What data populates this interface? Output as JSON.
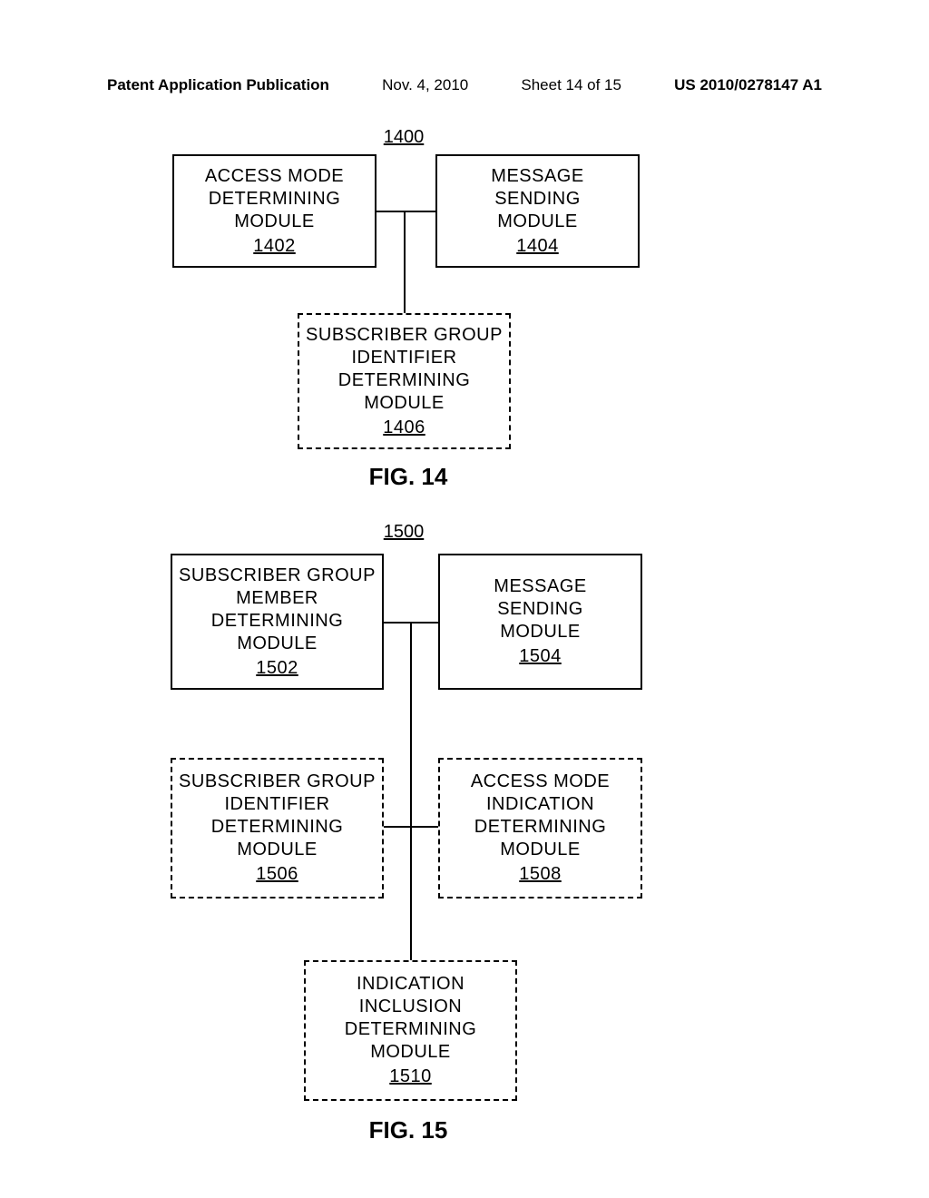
{
  "header": {
    "pub_label": "Patent Application Publication",
    "date": "Nov. 4, 2010",
    "sheet": "Sheet 14 of 15",
    "pubno": "US 2010/0278147 A1"
  },
  "fig14": {
    "ref": "1400",
    "label": "FIG. 14",
    "box1": {
      "line1": "ACCESS MODE",
      "line2": "DETERMINING",
      "line3": "MODULE",
      "num": "1402"
    },
    "box2": {
      "line1": "MESSAGE",
      "line2": "SENDING",
      "line3": "MODULE",
      "num": "1404"
    },
    "box3": {
      "line1": "SUBSCRIBER GROUP",
      "line2": "IDENTIFIER",
      "line3": "DETERMINING",
      "line4": "MODULE",
      "num": "1406"
    }
  },
  "fig15": {
    "ref": "1500",
    "label": "FIG. 15",
    "box1": {
      "line1": "SUBSCRIBER GROUP",
      "line2": "MEMBER",
      "line3": "DETERMINING",
      "line4": "MODULE",
      "num": "1502"
    },
    "box2": {
      "line1": "MESSAGE",
      "line2": "SENDING",
      "line3": "MODULE",
      "num": "1504"
    },
    "box3": {
      "line1": "SUBSCRIBER GROUP",
      "line2": "IDENTIFIER",
      "line3": "DETERMINING",
      "line4": "MODULE",
      "num": "1506"
    },
    "box4": {
      "line1": "ACCESS MODE",
      "line2": "INDICATION",
      "line3": "DETERMINING",
      "line4": "MODULE",
      "num": "1508"
    },
    "box5": {
      "line1": "INDICATION",
      "line2": "INCLUSION",
      "line3": "DETERMINING",
      "line4": "MODULE",
      "num": "1510"
    }
  }
}
